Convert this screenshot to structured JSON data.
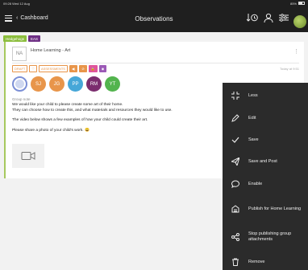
{
  "status": {
    "time": "09:28",
    "date": "Wed 12 Aug",
    "battery": "85%"
  },
  "appbar": {
    "back_label": "Cashboard",
    "title": "Observations"
  },
  "tags": [
    {
      "label": "Hedgehogs",
      "color": "#8bbd3c"
    },
    {
      "label": "EAS",
      "color": "#6e2f84"
    }
  ],
  "card": {
    "avatar_initials": "NA",
    "title": "Home Learning - Art",
    "badges": [
      "DRAFT",
      "ASSESSMENTS"
    ],
    "meta": "Today at 9:51",
    "children": [
      {
        "initials": "SJ",
        "color": "#e8954a"
      },
      {
        "initials": "JG",
        "color": "#e8954a"
      },
      {
        "initials": "PP",
        "color": "#46a7d8"
      },
      {
        "initials": "RM",
        "color": "#7b2d6e"
      },
      {
        "initials": "YT",
        "color": "#53b44e"
      }
    ],
    "note_label": "Group note",
    "note_lines": [
      "We would like your child to please create some art of their home.",
      "They can choose how to create this, and what materials and resources they would like to use.",
      "The video below shows a few examples of how your child could create their art.",
      "Please share a photo of your child's work. 😀"
    ]
  },
  "menu": [
    {
      "label": "Less",
      "icon": "collapse-icon"
    },
    {
      "label": "Edit",
      "icon": "pencil-icon"
    },
    {
      "label": "Save",
      "icon": "check-icon"
    },
    {
      "label": "Save and Post",
      "icon": "send-icon"
    },
    {
      "label": "Enable",
      "icon": "comment-icon"
    },
    {
      "label": "Publish for Home Learning",
      "icon": "home-learning-icon"
    },
    {
      "label": "Stop publishing group attachments",
      "icon": "share-icon"
    },
    {
      "label": "Remove",
      "icon": "trash-icon"
    }
  ]
}
